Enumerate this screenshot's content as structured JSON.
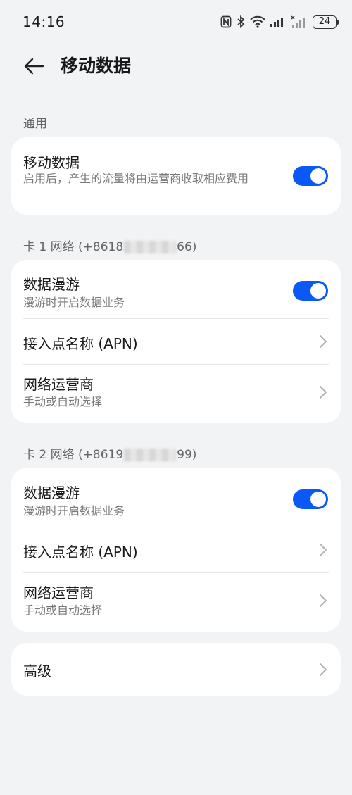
{
  "status": {
    "time": "14:16",
    "battery": "24"
  },
  "header": {
    "title": "移动数据"
  },
  "general": {
    "label": "通用",
    "mobile_data": {
      "title": "移动数据",
      "subtitle": "启用后，产生的流量将由运营商收取相应费用",
      "enabled": true
    }
  },
  "sim1": {
    "label_prefix": "卡 1 网络 (+8618",
    "label_suffix": "66)",
    "roaming": {
      "title": "数据漫游",
      "subtitle": "漫游时开启数据业务",
      "enabled": true
    },
    "apn": {
      "title": "接入点名称 (APN)"
    },
    "operator": {
      "title": "网络运营商",
      "subtitle": "手动或自动选择"
    }
  },
  "sim2": {
    "label_prefix": "卡 2 网络 (+8619",
    "label_suffix": "99)",
    "roaming": {
      "title": "数据漫游",
      "subtitle": "漫游时开启数据业务",
      "enabled": true
    },
    "apn": {
      "title": "接入点名称 (APN)"
    },
    "operator": {
      "title": "网络运营商",
      "subtitle": "手动或自动选择"
    }
  },
  "advanced": {
    "title": "高级"
  },
  "colors": {
    "accent": "#0a59f7",
    "background": "#f1f3f5",
    "card": "#ffffff"
  }
}
